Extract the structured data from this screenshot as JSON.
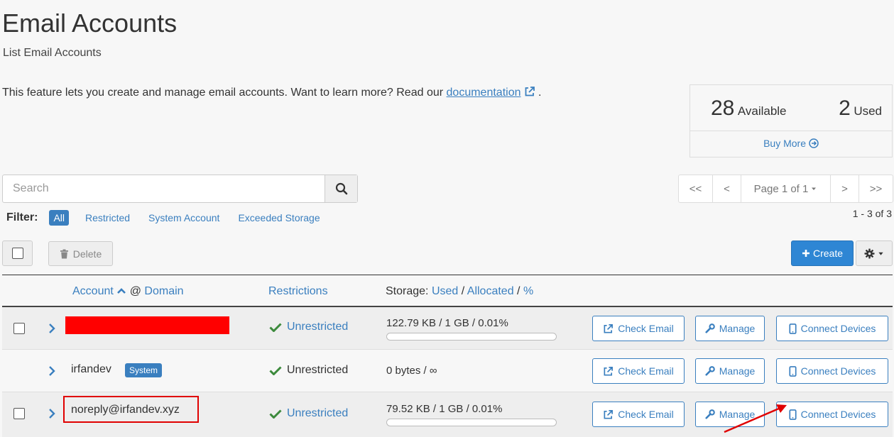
{
  "page": {
    "title": "Email Accounts",
    "subtitle": "List Email Accounts",
    "intro_text": "This feature lets you create and manage email accounts. Want to learn more? Read our",
    "intro_link": "documentation",
    "intro_end": "."
  },
  "quota": {
    "available_count": "28",
    "available_label": "Available",
    "used_count": "2",
    "used_label": "Used",
    "buy_more": "Buy More"
  },
  "search": {
    "placeholder": "Search"
  },
  "pagination": {
    "first": "<<",
    "prev": "<",
    "page_label": "Page 1 of 1",
    "next": ">",
    "last": ">>",
    "range": "1 - 3 of 3"
  },
  "filter": {
    "label": "Filter:",
    "items": [
      "All",
      "Restricted",
      "System Account",
      "Exceeded Storage"
    ],
    "active": "All"
  },
  "toolbar": {
    "delete_label": "Delete",
    "create_label": "Create"
  },
  "table": {
    "headers": {
      "account": "Account",
      "at": "@",
      "domain": "Domain",
      "restrictions": "Restrictions",
      "storage_prefix": "Storage:",
      "used": "Used",
      "sep1": "/",
      "allocated": "Allocated",
      "sep2": "/",
      "percent": "%"
    },
    "rows": [
      {
        "account": "",
        "redacted": true,
        "restriction": "Unrestricted",
        "storage": "122.79 KB / 1 GB / 0.01%",
        "usage_fraction": 0.0001
      },
      {
        "account": "irfandev",
        "badge": "System",
        "restriction": "Unrestricted",
        "storage": "0 bytes / ∞"
      },
      {
        "account": "noreply@irfandev.xyz",
        "restriction": "Unrestricted",
        "storage": "79.52 KB / 1 GB / 0.01%",
        "usage_fraction": 0.0001
      }
    ],
    "actions": {
      "check_email": "Check Email",
      "manage": "Manage",
      "connect_devices": "Connect Devices"
    }
  },
  "colors": {
    "accent": "#3a7fbf",
    "primary_button": "#2e86d4",
    "success": "#3c8a3c",
    "redaction": "#ff0000",
    "annotation": "#e00000"
  }
}
